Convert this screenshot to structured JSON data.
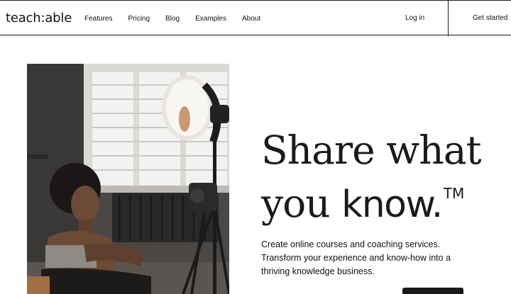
{
  "header": {
    "logo": "teach:able",
    "nav": [
      "Features",
      "Pricing",
      "Blog",
      "Examples",
      "About"
    ],
    "login": "Log in",
    "get_started": "Get started"
  },
  "hero": {
    "headline_line1": "Share what",
    "headline_you": "you ",
    "headline_know": "know.",
    "headline_tm": "TM",
    "subtext": "Create online courses and coaching services. Transform your experience and know-how into a thriving knowledge business."
  }
}
